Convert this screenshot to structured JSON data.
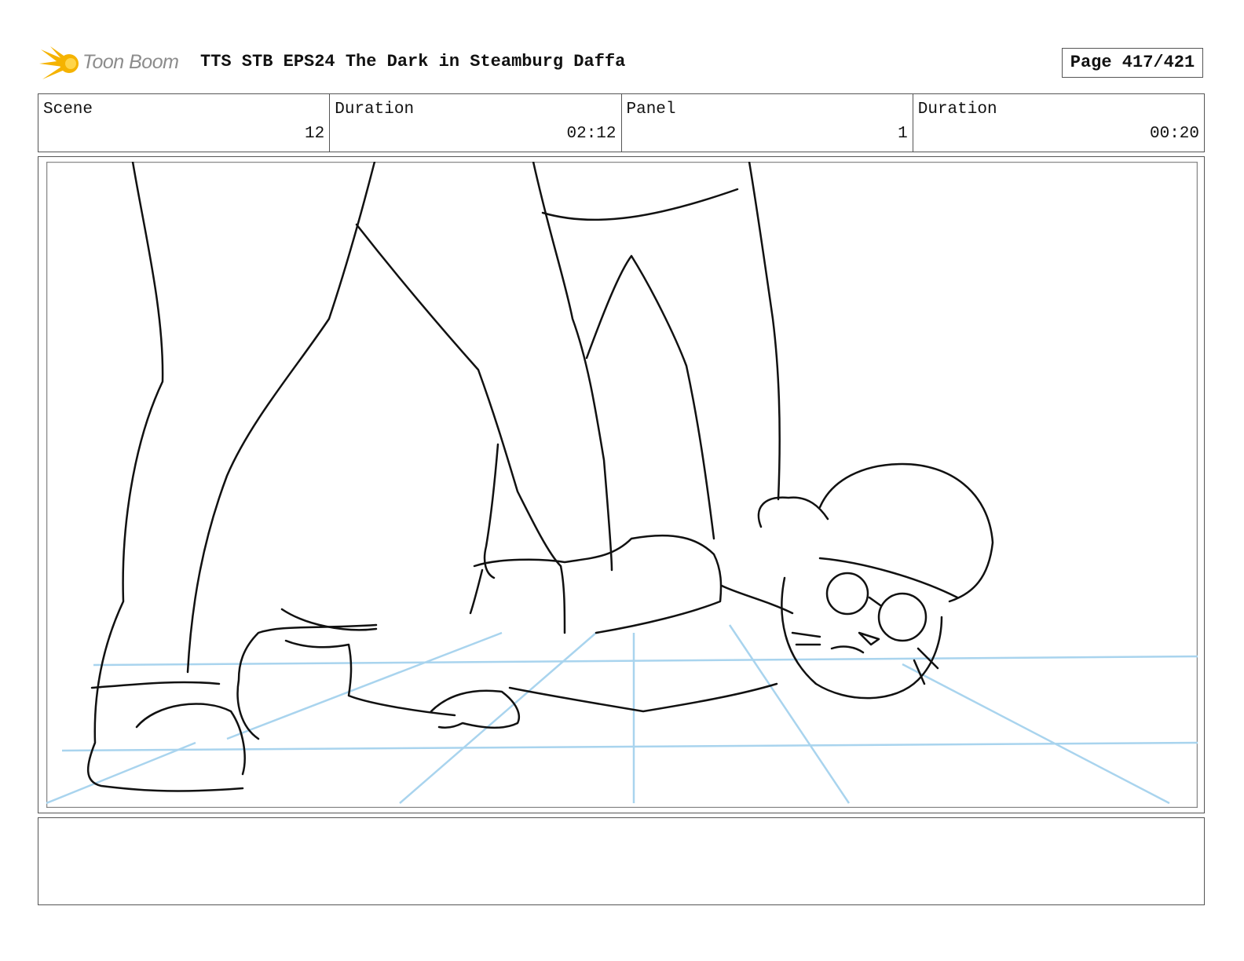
{
  "header": {
    "logo_text": "Toon Boom",
    "title": "TTS STB EPS24 The Dark in Steamburg Daffa",
    "page": "Page 417/421"
  },
  "info": {
    "scene_label": "Scene",
    "scene_value": "12",
    "scene_duration_label": "Duration",
    "scene_duration_value": "02:12",
    "panel_label": "Panel",
    "panel_value": "1",
    "panel_duration_label": "Duration",
    "panel_duration_value": "00:20"
  },
  "notes": {
    "text": ""
  },
  "colors": {
    "logo_accent": "#f5b300",
    "perspective_grid": "#a9d4ee",
    "sketch_line": "#111111"
  }
}
